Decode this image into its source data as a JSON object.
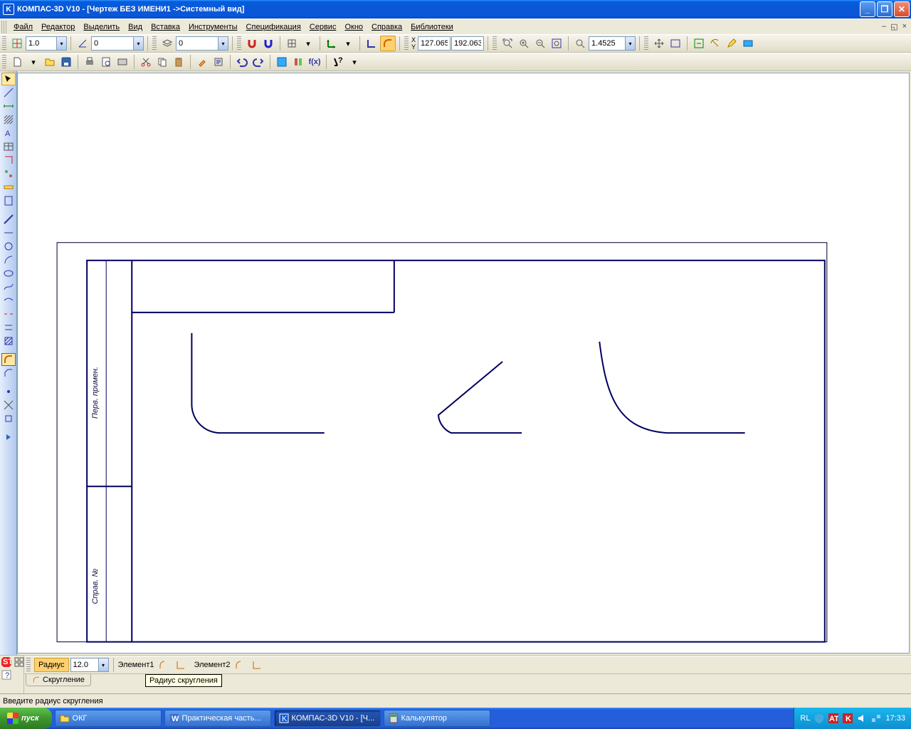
{
  "title": "КОМПАС-3D V10 - [Чертеж БЕЗ ИМЕНИ1 ->Системный вид]",
  "menu": {
    "file": "Файл",
    "edit": "Редактор",
    "select": "Выделить",
    "view": "Вид",
    "insert": "Вставка",
    "tools": "Инструменты",
    "spec": "Спецификация",
    "service": "Сервис",
    "window": "Окно",
    "help": "Справка",
    "libs": "Библиотеки"
  },
  "toolbar": {
    "step": "1.0",
    "angle": "0",
    "layer": "0",
    "x": "127.065",
    "y": "192.063",
    "zoom": "1.4525"
  },
  "props": {
    "radius_label": "Радиус",
    "radius_value": "12.0",
    "elem1": "Элемент1",
    "elem2": "Элемент2",
    "tab": "Скругление",
    "tooltip": "Радиус скругления"
  },
  "status": "Введите радиус скругления",
  "sideframe": {
    "pp": "Перв. примен.",
    "sp": "Справ. №"
  },
  "taskbar": {
    "start": "пуск",
    "t1": "ОКГ",
    "t2": "Практическая часть...",
    "t3": "КОМПАС-3D V10 - [Ч...",
    "t4": "Калькулятор",
    "lang": "RL",
    "clock": "17:33"
  }
}
